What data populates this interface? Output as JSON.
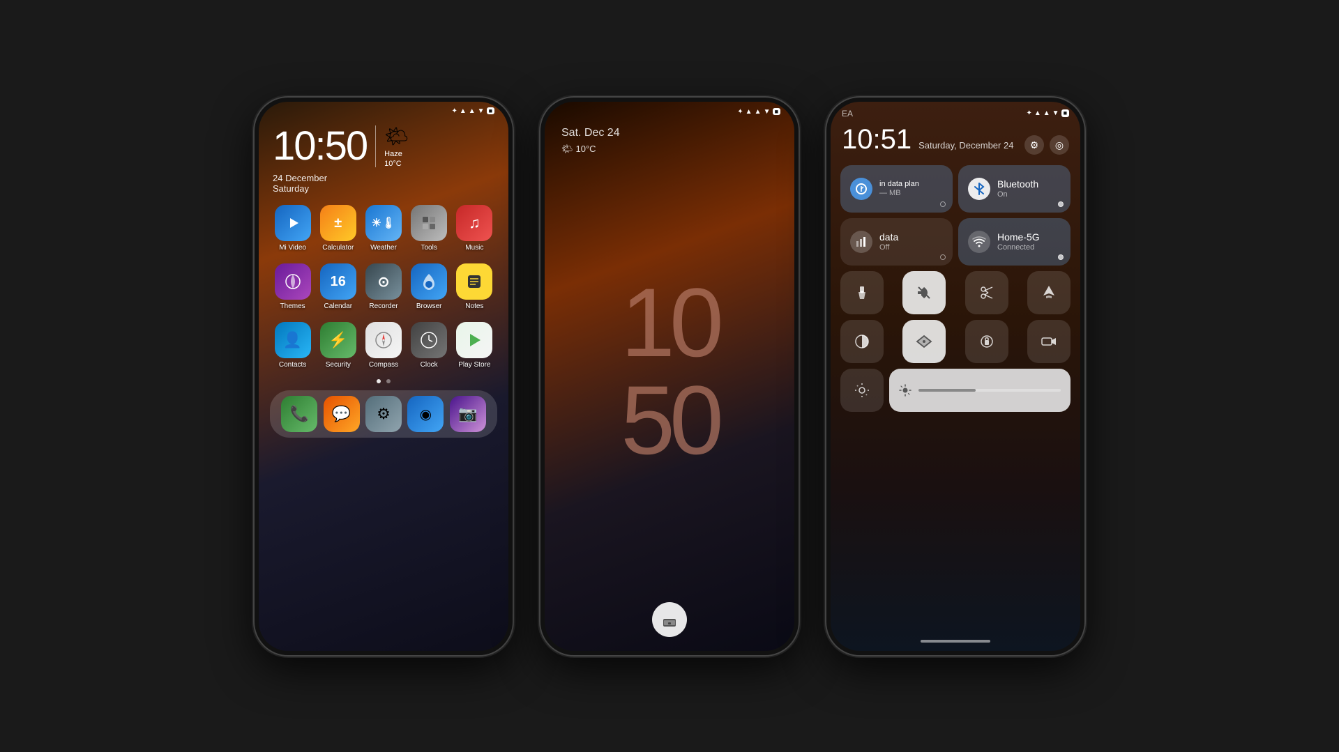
{
  "phone1": {
    "status_bar": {
      "icons": "★ ▲ ▼ ● 🔋"
    },
    "clock": {
      "time": "10:50",
      "date": "24  December",
      "day": "Saturday"
    },
    "weather": {
      "icon": "🌤",
      "description": "Haze",
      "temp": "10°C"
    },
    "apps_row1": [
      {
        "label": "Mi Video",
        "icon": "▶",
        "class": "icon-mivideo"
      },
      {
        "label": "Calculator",
        "icon": "±",
        "class": "icon-calculator"
      },
      {
        "label": "Weather",
        "icon": "☀",
        "class": "icon-weather"
      },
      {
        "label": "Tools",
        "icon": "⚙",
        "class": "icon-tools"
      },
      {
        "label": "Music",
        "icon": "♫",
        "class": "icon-music"
      }
    ],
    "apps_row2": [
      {
        "label": "Themes",
        "icon": "◈",
        "class": "icon-themes"
      },
      {
        "label": "Calendar",
        "icon": "16",
        "class": "icon-calendar"
      },
      {
        "label": "Recorder",
        "icon": "⊙",
        "class": "icon-recorder"
      },
      {
        "label": "Browser",
        "icon": "◉",
        "class": "icon-browser"
      },
      {
        "label": "Notes",
        "icon": "≡",
        "class": "icon-notes"
      }
    ],
    "apps_row3": [
      {
        "label": "Contacts",
        "icon": "👤",
        "class": "icon-contacts"
      },
      {
        "label": "Security",
        "icon": "⚡",
        "class": "icon-security"
      },
      {
        "label": "Compass",
        "icon": "◎",
        "class": "icon-compass"
      },
      {
        "label": "Clock",
        "icon": "◷",
        "class": "icon-clock"
      },
      {
        "label": "Play Store",
        "icon": "▷",
        "class": "icon-playstore"
      }
    ],
    "dock": [
      {
        "label": "Phone",
        "icon": "📞",
        "class": "icon-phone-dock"
      },
      {
        "label": "Messages",
        "icon": "💬",
        "class": "icon-messages-dock"
      },
      {
        "label": "Settings",
        "icon": "⚙",
        "class": "icon-settings-dock"
      },
      {
        "label": "Browser",
        "icon": "◉",
        "class": "icon-mifeng-dock"
      },
      {
        "label": "Camera",
        "icon": "📷",
        "class": "icon-camera-dock"
      }
    ]
  },
  "phone2": {
    "status_bar": {
      "icons": "★ ▲ ▼ ● 🔋"
    },
    "date": "Sat. Dec  24",
    "weather": {
      "icon": "🌤",
      "temp": "10°C"
    },
    "time_big": {
      "hours": "10",
      "minutes": "50"
    },
    "lock_button": "▬"
  },
  "phone3": {
    "ea_label": "EA",
    "status_bar_icons": "★ ▲ ▼ 🔋",
    "time": "10:51",
    "date": "Saturday, December 24",
    "tiles": {
      "data_plan": {
        "title": "in data plan",
        "subtitle": "— MB",
        "active": false
      },
      "bluetooth": {
        "title": "Bluetooth",
        "subtitle": "On",
        "active": true
      },
      "data": {
        "title": "data",
        "subtitle": "Off",
        "active": false
      },
      "wifi": {
        "title": "Home-5G",
        "subtitle": "Connected",
        "active": true
      }
    },
    "small_buttons": {
      "flashlight": "🔦",
      "mute": "🔔",
      "scissors": "✂",
      "airplane": "✈"
    },
    "small_buttons2": {
      "contrast": "◐",
      "location": "◎",
      "lock_rotate": "⊕",
      "video": "▶"
    },
    "bottom_row": {
      "auto_brightness": "◑",
      "brightness_icon": "☀"
    }
  }
}
